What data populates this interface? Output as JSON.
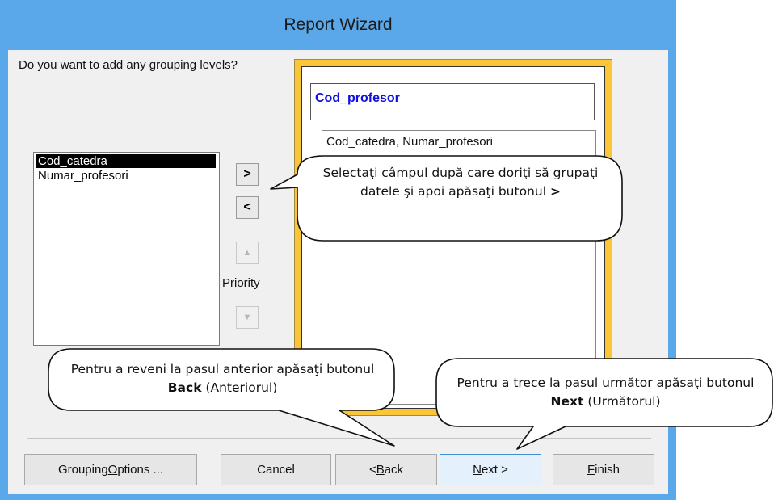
{
  "window": {
    "title": "Report Wizard"
  },
  "prompt": "Do you want to add any grouping levels?",
  "fields": [
    "Cod_catedra",
    "Numar_profesori"
  ],
  "buttons_side": {
    "add": ">",
    "remove": "<",
    "up": "▲",
    "down": "▼",
    "priority": "Priority"
  },
  "preview": {
    "group_header": "Cod_profesor",
    "detail": "Cod_catedra, Numar_profesori"
  },
  "callouts": {
    "select": "Selectaţi câmpul după care doriţi să grupaţi datele şi apoi apăsaţi butonul",
    "select_bold": ">",
    "back_pre": "Pentru a reveni la pasul anterior apăsaţi butonul",
    "back_bold": "Back",
    "back_post": "(Anteriorul)",
    "next_pre": "Pentru a trece la pasul următor apăsaţi butonul",
    "next_bold": "Next",
    "next_post": "(Următorul)"
  },
  "footer": {
    "grouping_pre": "Grouping ",
    "grouping_u": "O",
    "grouping_post": "ptions ...",
    "cancel": "Cancel",
    "back_pre": "< ",
    "back_u": "B",
    "back_post": "ack",
    "next_u": "N",
    "next_post": "ext >",
    "finish_u": "F",
    "finish_post": "inish"
  }
}
